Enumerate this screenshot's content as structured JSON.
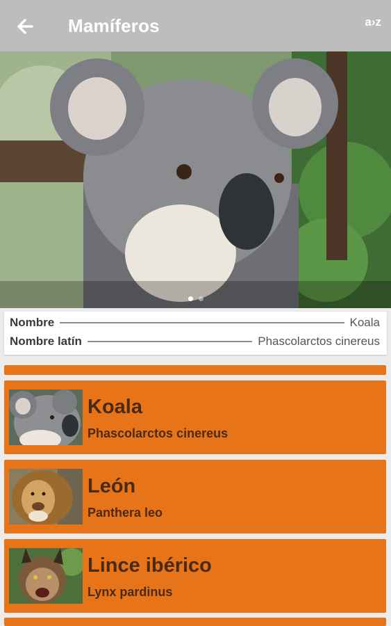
{
  "appbar": {
    "title": "Mamíferos",
    "sort_label": "a›z"
  },
  "hero": {
    "active_index": 0,
    "page_count": 2
  },
  "info": {
    "name_label": "Nombre",
    "name_value": "Koala",
    "latin_label": "Nombre latín",
    "latin_value": "Phascolarctos cinereus"
  },
  "list": {
    "items": [
      {
        "name": "Koala",
        "latin": "Phascolarctos cinereus"
      },
      {
        "name": "León",
        "latin": "Panthera leo"
      },
      {
        "name": "Lince ibérico",
        "latin": "Lynx pardinus"
      }
    ]
  },
  "colors": {
    "appbar": "#bdbdbd",
    "card": "#e8741a",
    "card_text": "#4a2a10"
  }
}
